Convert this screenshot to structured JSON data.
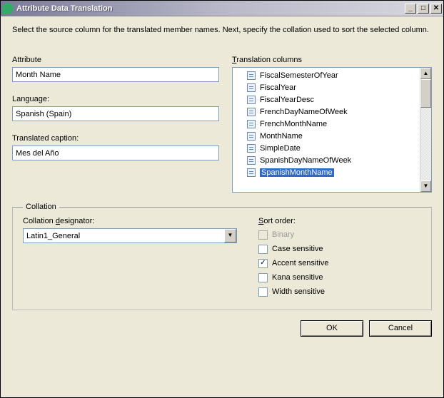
{
  "window": {
    "title": "Attribute Data Translation"
  },
  "instruction": "Select the source column for the translated member names.  Next, specify the collation used to sort the selected column.",
  "labels": {
    "attribute": "Attribute",
    "language": "Language:",
    "translated_caption": "Translated caption:",
    "translation_columns": "Translation columns"
  },
  "fields": {
    "attribute": "Month Name",
    "language": "Spanish (Spain)",
    "translated_caption": "Mes del Año"
  },
  "columns": [
    {
      "name": "FiscalSemesterOfYear",
      "selected": false
    },
    {
      "name": "FiscalYear",
      "selected": false
    },
    {
      "name": "FiscalYearDesc",
      "selected": false
    },
    {
      "name": "FrenchDayNameOfWeek",
      "selected": false
    },
    {
      "name": "FrenchMonthName",
      "selected": false
    },
    {
      "name": "MonthName",
      "selected": false
    },
    {
      "name": "SimpleDate",
      "selected": false
    },
    {
      "name": "SpanishDayNameOfWeek",
      "selected": false
    },
    {
      "name": "SpanishMonthName",
      "selected": true
    }
  ],
  "collation": {
    "legend": "Collation",
    "designator_label": "Collation designator:",
    "designator_value": "Latin1_General",
    "sort_order_label": "Sort order:",
    "options": [
      {
        "label": "Binary",
        "checked": false,
        "disabled": true,
        "underline": "B"
      },
      {
        "label": "Case sensitive",
        "checked": false,
        "disabled": false,
        "underline": "C"
      },
      {
        "label": "Accent sensitive",
        "checked": true,
        "disabled": false,
        "underline": "A"
      },
      {
        "label": "Kana sensitive",
        "checked": false,
        "disabled": false,
        "underline": "K"
      },
      {
        "label": "Width sensitive",
        "checked": false,
        "disabled": false,
        "underline": "W"
      }
    ]
  },
  "buttons": {
    "ok": "OK",
    "cancel": "Cancel"
  }
}
